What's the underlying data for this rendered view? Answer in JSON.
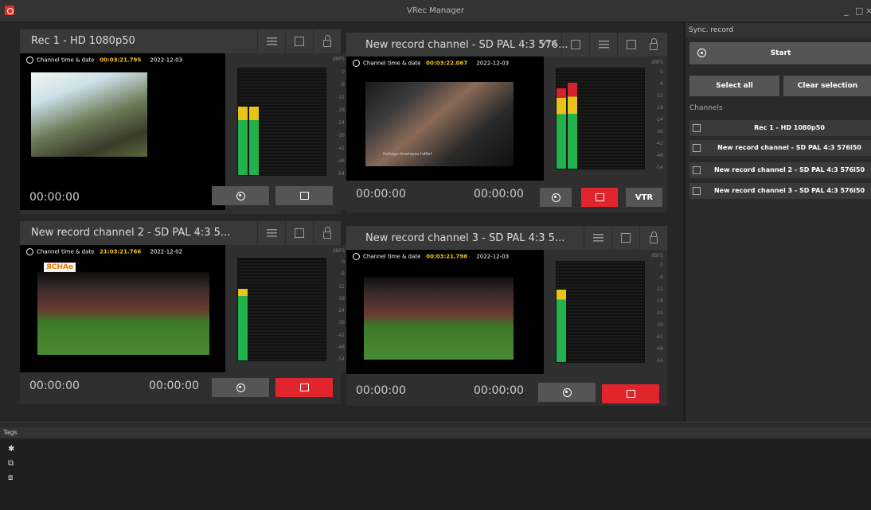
{
  "window": {
    "title": "VRec Manager",
    "minimize": "_",
    "maximize": "□",
    "close": "×"
  },
  "tiles": [
    {
      "title": "Rec 1 - HD 1080p50",
      "info_label": "Channel time & date",
      "time": "00:03:21.795",
      "date": "2022-12-03",
      "tc1": "00:00:00",
      "tc2": "",
      "has_vtr": false,
      "record_active": false
    },
    {
      "title": "New record channel - SD PAL 4:3 576...",
      "info_label": "Channel time & date",
      "time": "00:03:22.067",
      "date": "2022-12-03",
      "tc1": "00:00:00",
      "tc2": "00:00:00",
      "has_vtr": true,
      "vtr_label": "VTR",
      "vtr_small": "VTR",
      "record_active": true,
      "overlay": "footage.timelapse.hdRef"
    },
    {
      "title": "New record channel 2 - SD PAL 4:3 5...",
      "info_label": "Channel time & date",
      "time": "21:03:21.766",
      "date": "2022-12-02",
      "tc1": "00:00:00",
      "tc2": "00:00:00",
      "has_vtr": false,
      "record_active": true,
      "logo": "ЯCHAe"
    },
    {
      "title": "New record channel 3 - SD PAL 4:3 5...",
      "info_label": "Channel time & date",
      "time": "00:03:21.796",
      "date": "2022-12-03",
      "tc1": "00:00:00",
      "tc2": "00:00:00",
      "has_vtr": false,
      "record_active": true
    }
  ],
  "meter": {
    "unit": "dBFS",
    "scale": [
      "0",
      "-6",
      "-12",
      "-18",
      "-24",
      "-36",
      "-42",
      "-48",
      "-54"
    ]
  },
  "sync": {
    "title": "Sync. record",
    "start_label": "Start",
    "select_all": "Select all",
    "clear_selection": "Clear selection",
    "channels_label": "Channels",
    "channels": [
      "Rec 1 - HD 1080p50",
      "New record channel - SD PAL 4:3 576i50",
      "New record channel 2 - SD PAL 4:3 576i50",
      "New record channel 3 - SD PAL 4:3 576i50"
    ]
  },
  "tags": {
    "title": "Tags"
  },
  "colors": {
    "accent_red": "#e0262c",
    "time_yellow": "#f0c418",
    "meter_green": "#22b14c",
    "meter_yellow": "#e8c41a",
    "meter_red": "#d4232a"
  }
}
